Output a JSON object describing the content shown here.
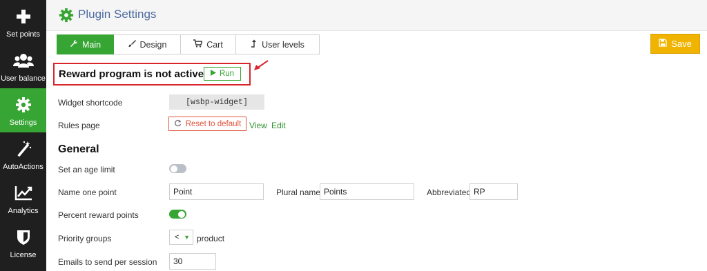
{
  "sidebar": {
    "items": [
      {
        "label": "Set points",
        "icon": "plus-icon"
      },
      {
        "label": "User balance",
        "icon": "users-icon"
      },
      {
        "label": "Settings",
        "icon": "gear-icon"
      },
      {
        "label": "AutoActions",
        "icon": "magic-wand-icon"
      },
      {
        "label": "Analytics",
        "icon": "chart-line-icon"
      },
      {
        "label": "License",
        "icon": "shield-icon"
      }
    ],
    "active": "Settings"
  },
  "header": {
    "title": "Plugin Settings"
  },
  "tabs": [
    {
      "label": "Main",
      "icon": "wrench-icon"
    },
    {
      "label": "Design",
      "icon": "brush-icon"
    },
    {
      "label": "Cart",
      "icon": "cart-icon"
    },
    {
      "label": "User levels",
      "icon": "level-up-icon"
    }
  ],
  "save_label": "Save",
  "status": {
    "text": "Reward program is not active",
    "run_label": "Run"
  },
  "fields": {
    "widget_shortcode_label": "Widget shortcode",
    "widget_shortcode_value": "[wsbp-widget]",
    "rules_page_label": "Rules page",
    "reset_label": "Reset to default",
    "view_label": "View",
    "edit_label": "Edit"
  },
  "general": {
    "title": "General",
    "age_limit_label": "Set an age limit",
    "age_limit_on": false,
    "name_one_point_label": "Name one point",
    "name_one_point_value": "Point",
    "plural_name_label": "Plural name",
    "plural_name_value": "Points",
    "abbreviated_label": "Abbreviated",
    "abbreviated_value": "RP",
    "percent_reward_label": "Percent reward points",
    "percent_reward_on": true,
    "priority_groups_label": "Priority groups",
    "priority_groups_value": "<",
    "priority_groups_suffix": "product",
    "emails_label": "Emails to send per session",
    "emails_value": "30"
  },
  "colors": {
    "accent_green": "#37a534",
    "save_yellow": "#f0b400",
    "highlight_red": "#d9252b",
    "title_blue": "#4d6aa0"
  }
}
